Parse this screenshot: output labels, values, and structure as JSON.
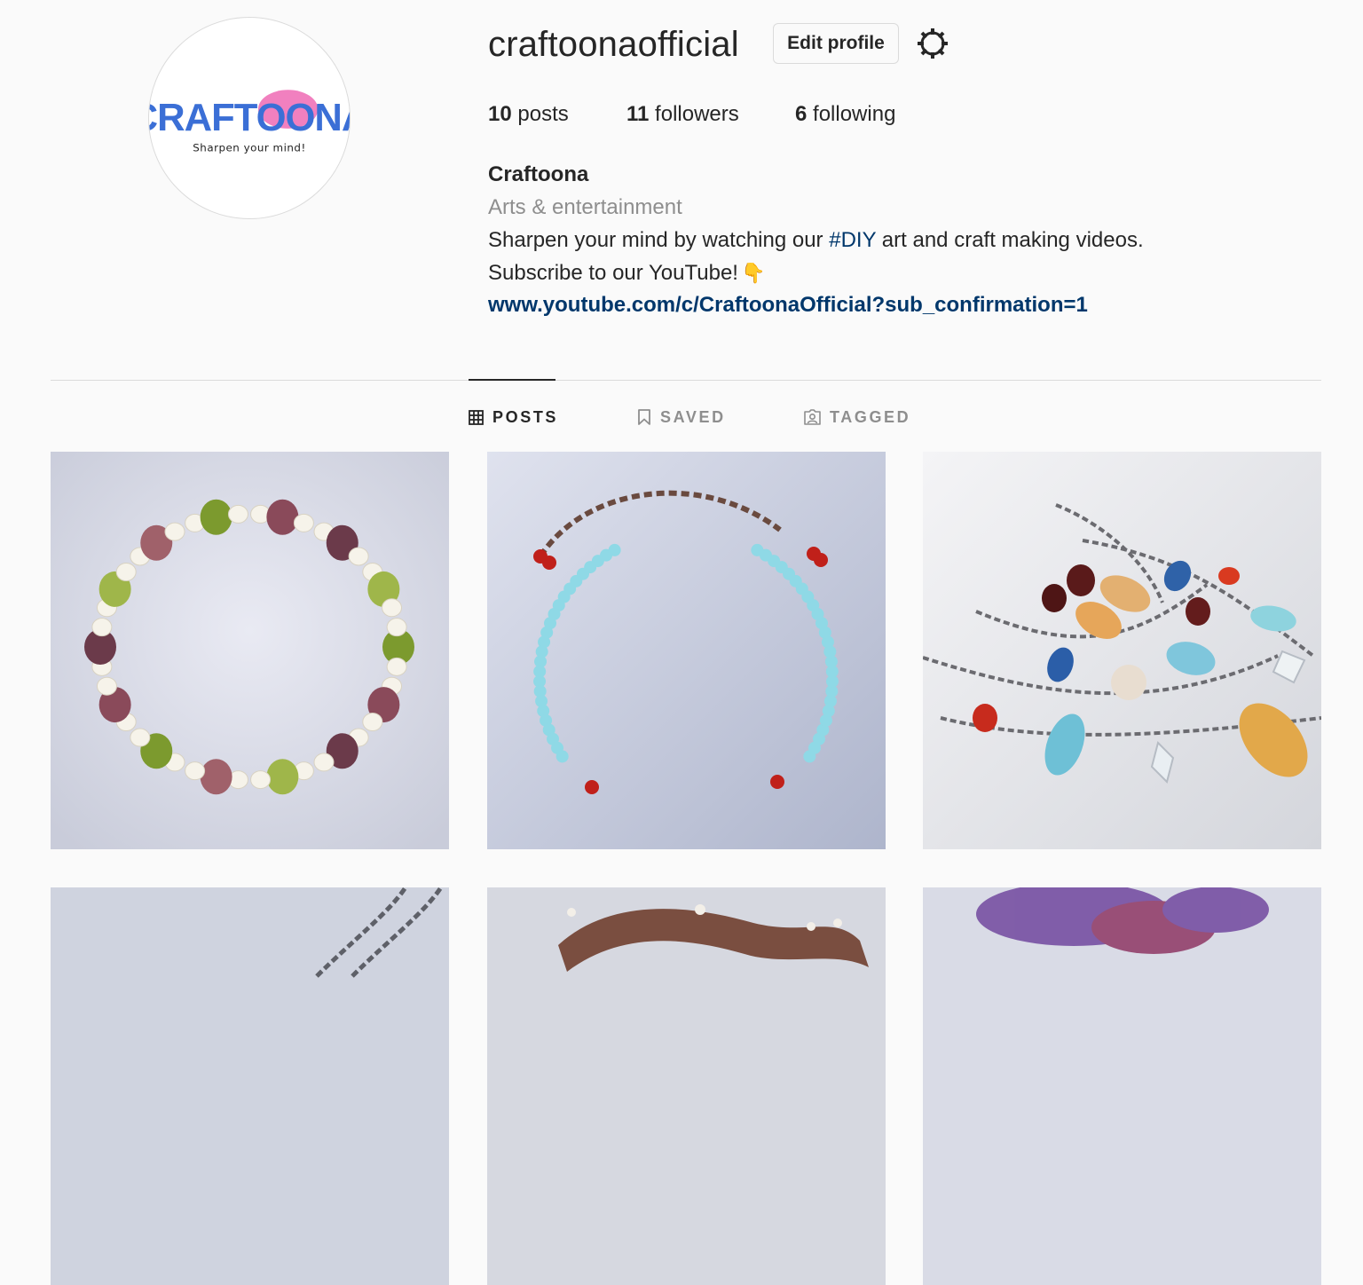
{
  "profile": {
    "logo_text": "CRAFTOONA",
    "logo_tagline": "Sharpen your mind!",
    "username": "craftoonaofficial",
    "edit_button": "Edit profile",
    "stats": {
      "posts_count": "10",
      "posts_label": "posts",
      "followers_count": "11",
      "followers_label": "followers",
      "following_count": "6",
      "following_label": "following"
    },
    "full_name": "Craftoona",
    "category": "Arts & entertainment",
    "bio_line1_before": "Sharpen your mind by watching our ",
    "bio_hashtag": "#DIY",
    "bio_line1_after": " art and craft making videos.",
    "bio_line2": "Subscribe to our YouTube!",
    "bio_emoji": "👇",
    "link": "www.youtube.com/c/CraftoonaOfficial?sub_confirmation=1"
  },
  "tabs": [
    {
      "label": "POSTS",
      "icon": "grid-icon",
      "active": true
    },
    {
      "label": "SAVED",
      "icon": "bookmark-icon",
      "active": false
    },
    {
      "label": "TAGGED",
      "icon": "tagged-person-icon",
      "active": false
    }
  ],
  "colors": {
    "background": "#fafafa",
    "text": "#262626",
    "muted": "#8e8e8e",
    "link": "#00376b",
    "border": "#dbdbdb",
    "logo_blue": "#3b6fd6",
    "logo_pink": "#ee6ab4"
  },
  "posts": [
    {
      "subject": "bead-bracelet-photo"
    },
    {
      "subject": "turquoise-necklace-photo"
    },
    {
      "subject": "chain-jewelry-set-photo"
    },
    {
      "subject": "chain-photo"
    },
    {
      "subject": "ribbon-photo"
    },
    {
      "subject": "feather-photo"
    }
  ]
}
